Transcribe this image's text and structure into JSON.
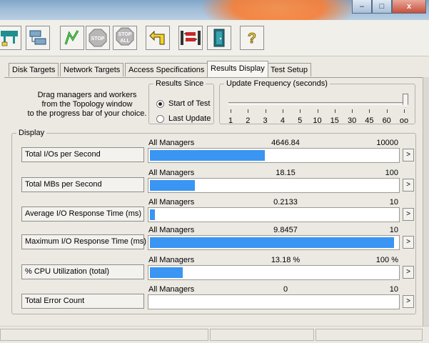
{
  "tabs": [
    {
      "label": "Disk Targets"
    },
    {
      "label": "Network Targets"
    },
    {
      "label": "Access Specifications"
    },
    {
      "label": "Results Display"
    },
    {
      "label": "Test Setup"
    }
  ],
  "toolbar": {
    "icons": [
      "topology-icon",
      "network-workers-icon",
      "start-icon",
      "stop-icon",
      "stop-all-icon",
      "reset-icon",
      "new-manager-icon",
      "exit-icon",
      "help-icon"
    ],
    "stop_label": "STOP",
    "stop_all_label_1": "STOP",
    "stop_all_label_2": "ALL",
    "help_label": "?"
  },
  "instructions": {
    "line1": "Drag managers and workers",
    "line2": "from the Topology window",
    "line3": "to the progress bar of your choice."
  },
  "results_since": {
    "title": "Results Since",
    "options": [
      "Start of Test",
      "Last Update"
    ],
    "selected": "Start of Test"
  },
  "update_frequency": {
    "title": "Update Frequency (seconds)",
    "ticks": [
      "1",
      "2",
      "3",
      "4",
      "5",
      "10",
      "15",
      "30",
      "45",
      "60",
      "oo"
    ],
    "selected": "oo"
  },
  "display": {
    "title": "Display",
    "rows": [
      {
        "label": "Total I/Os per Second",
        "source": "All Managers",
        "value": "4646.84",
        "max": "10000",
        "fraction": 0.4647
      },
      {
        "label": "Total MBs per Second",
        "source": "All Managers",
        "value": "18.15",
        "max": "100",
        "fraction": 0.1815
      },
      {
        "label": "Average I/O Response Time (ms)",
        "source": "All Managers",
        "value": "0.2133",
        "max": "10",
        "fraction": 0.0213
      },
      {
        "label": "Maximum I/O Response Time (ms)",
        "source": "All Managers",
        "value": "9.8457",
        "max": "10",
        "fraction": 0.9846
      },
      {
        "label": "% CPU Utilization (total)",
        "source": "All Managers",
        "value": "13.18 %",
        "max": "100 %",
        "fraction": 0.1318
      },
      {
        "label": "Total Error Count",
        "source": "All Managers",
        "value": "0",
        "max": "10",
        "fraction": 0
      }
    ],
    "expand_label": ">"
  },
  "window": {
    "minimize": "–",
    "maximize": "□",
    "close": "x"
  },
  "colors": {
    "bar_fill": "#3a95f3",
    "background": "#ece9e3"
  }
}
